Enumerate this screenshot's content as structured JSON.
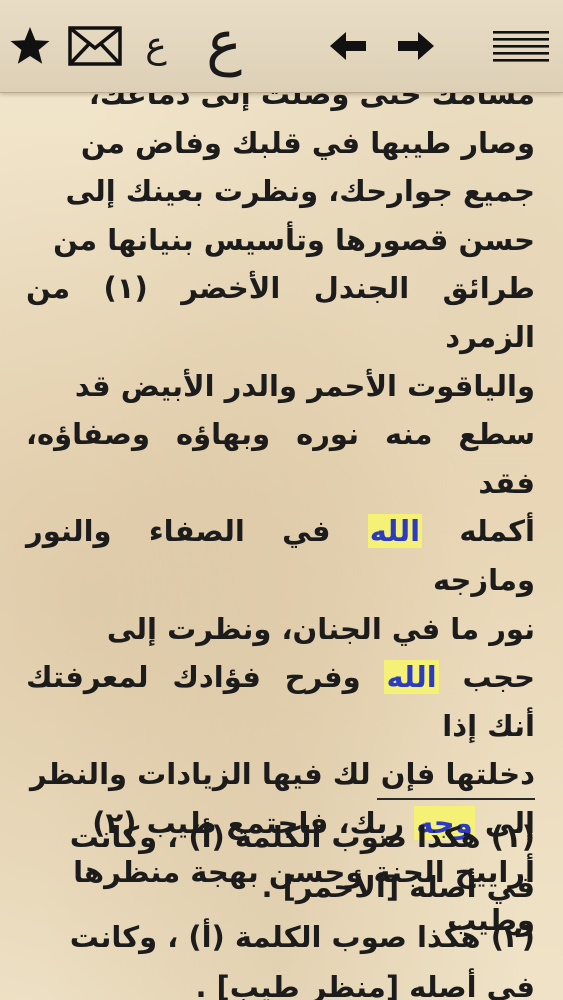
{
  "toolbar": {
    "icons": [
      "star-icon",
      "mail-icon",
      "font-small-icon",
      "font-large-icon",
      "arrow-left-icon",
      "arrow-right-icon",
      "menu-icon"
    ],
    "font_small_glyph": "ع",
    "font_large_glyph": "ع"
  },
  "colors": {
    "background": "#efe3c9",
    "toolbar": "#e3d6bd",
    "text": "#1c1c1c",
    "highlight_background": "#f5f076",
    "highlight_text": "#2b3bc4"
  },
  "body": {
    "lines": [
      "مشامك حتى وصلت إلى دماغك،",
      "وصار طيبها في قلبك وفاض من",
      "جميع جوارحك، ونظرت بعينك إلى",
      "حسن قصورها وتأسيس بنيانها من",
      "طرائق الجندل الأخضر (١) من الزمرد",
      "والياقوت الأحمر والدر الأبيض قد",
      "سطع منه نوره وبهاؤه وصفاؤه، فقد"
    ],
    "line8_before": "أكمله ",
    "line8_highlight": "الله",
    "line8_after": " في الصفاء والنور ومازجه",
    "line9": "نور ما في الجنان، ونظرت إلى",
    "line10_before": "حجب ",
    "line10_highlight": "الله",
    "line10_after": " وفرح فؤادك لمعرفتك أنك إذا",
    "line11": "دخلتها فإن لك فيها الزيادات والنظر",
    "line12_before": "إلى ",
    "line12_highlight": "وجه",
    "line12_after": " ربك، فاجتمع طيب (٢)",
    "line13": "أراييح الجنة وحسن بهجة منظرها",
    "line14": "وطيب"
  },
  "notes": {
    "lines": [
      "(١) هكذا صوب الكلمة (أ) ، وكانت",
      "في أصله [الأحمر] .",
      "(٢) هكذا صوب الكلمة (أ) ، وكانت",
      "في أصله [منظر طيب] ."
    ]
  }
}
